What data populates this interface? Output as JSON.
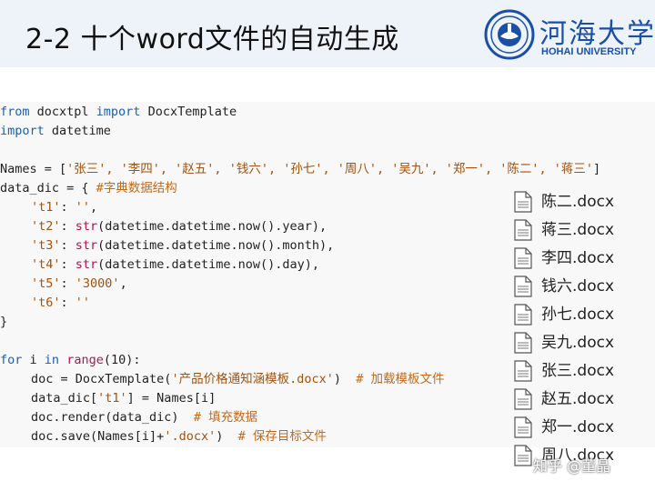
{
  "slide": {
    "title": "2-2 十个word文件的自动生成",
    "university_cn": "河海大学",
    "university_en": "HOHAI UNIVERSITY",
    "watermark": "知乎 @董晶"
  },
  "code": {
    "l1": {
      "kw1": "from",
      "mod": " docxtpl ",
      "kw2": "import",
      "name": " DocxTemplate"
    },
    "l2": {
      "kw1": "import",
      "name": " datetime"
    },
    "l4": {
      "pre": "Names = [",
      "items": "'张三', '李四', '赵五', '钱六', '孙七', '周八', '吴九', '郑一', '陈二', '蒋三'",
      "post": "]"
    },
    "l5": {
      "pre": "data_dic = { ",
      "comment": "#字典数据结构"
    },
    "l6": {
      "key": "'t1'",
      "sep": ": ",
      "val": "''",
      "end": ","
    },
    "l7": {
      "key": "'t2'",
      "sep": ": ",
      "fn": "str",
      "rest": "(datetime.datetime.now().year),"
    },
    "l8": {
      "key": "'t3'",
      "sep": ": ",
      "fn": "str",
      "rest": "(datetime.datetime.now().month),"
    },
    "l9": {
      "key": "'t4'",
      "sep": ": ",
      "fn": "str",
      "rest": "(datetime.datetime.now().day),"
    },
    "l10": {
      "key": "'t5'",
      "sep": ": ",
      "val": "'3000'",
      "end": ","
    },
    "l11": {
      "key": "'t6'",
      "sep": ": ",
      "val": "''"
    },
    "l12": {
      "text": "}"
    },
    "l14": {
      "kw1": "for",
      "var": " i ",
      "kw2": "in",
      "sp": " ",
      "fn": "range",
      "rest": "(10):"
    },
    "l15": {
      "pre": "doc = DocxTemplate(",
      "str": "'产品价格通知涵模板.docx'",
      "post": ")  ",
      "comment": "# 加载模板文件"
    },
    "l16": {
      "pre": "data_dic[",
      "str": "'t1'",
      "post": "] = Names[i]"
    },
    "l17": {
      "pre": "doc.render(data_dic)  ",
      "comment": "# 填充数据"
    },
    "l18": {
      "pre": "doc.save(Names[i]+",
      "str": "'.docx'",
      "post": ")  ",
      "comment": "# 保存目标文件"
    }
  },
  "files": [
    "陈二.docx",
    "蒋三.docx",
    "李四.docx",
    "钱六.docx",
    "孙七.docx",
    "吴九.docx",
    "张三.docx",
    "赵五.docx",
    "郑一.docx",
    "周八.docx"
  ],
  "colors": {
    "keyword": "#1a5fb4",
    "string": "#a2520e",
    "comment": "#c26a1c",
    "builtin": "#b0154b",
    "university": "#1a4fa8"
  },
  "icons": {
    "logo": "university-seal-icon",
    "file": "document-file-icon"
  }
}
